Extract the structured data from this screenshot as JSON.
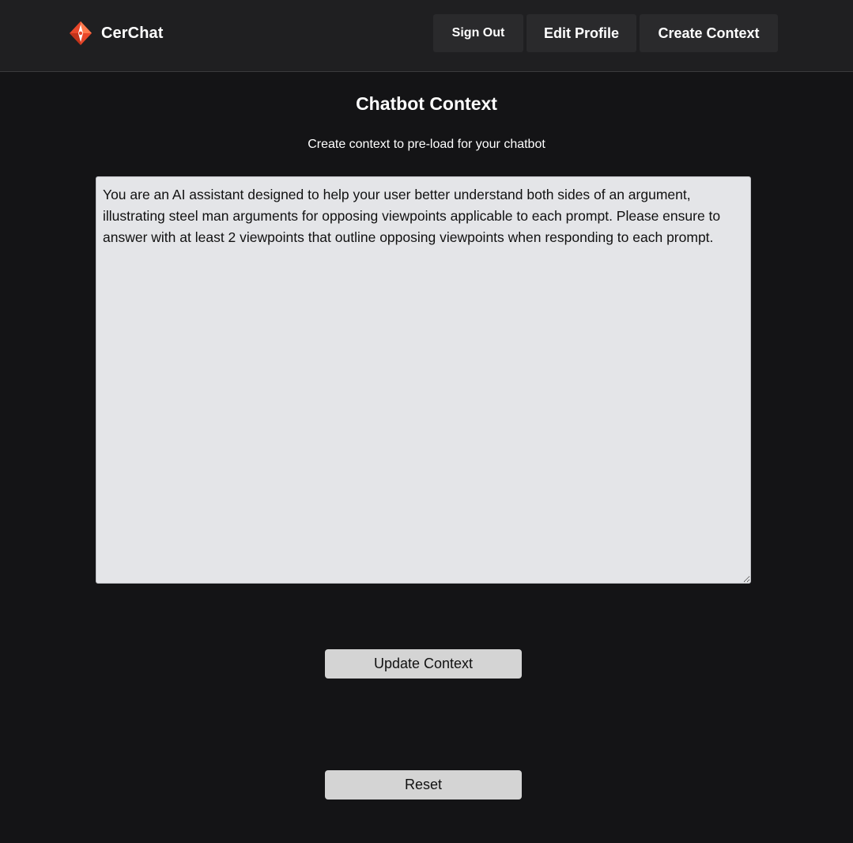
{
  "header": {
    "brand_name": "CerChat",
    "logo_icon": "cerchat-diamond-logo-icon",
    "nav": {
      "sign_out": "Sign Out",
      "edit_profile": "Edit Profile",
      "create_context": "Create Context"
    }
  },
  "main": {
    "title": "Chatbot Context",
    "subtitle": "Create context to pre-load for your chatbot",
    "context_value": "You are an AI assistant designed to help your user better understand both sides of an argument, illustrating steel man arguments for opposing viewpoints applicable to each prompt. Please ensure to answer with at least 2 viewpoints that outline opposing viewpoints when responding to each prompt.",
    "update_label": "Update Context",
    "reset_label": "Reset"
  },
  "colors": {
    "background": "#141416",
    "header_background": "#1f1f21",
    "nav_button": "#2a2a2c",
    "textarea_background": "#e4e5e8",
    "action_button": "#d4d4d4",
    "logo_accent": "#e8472a"
  }
}
